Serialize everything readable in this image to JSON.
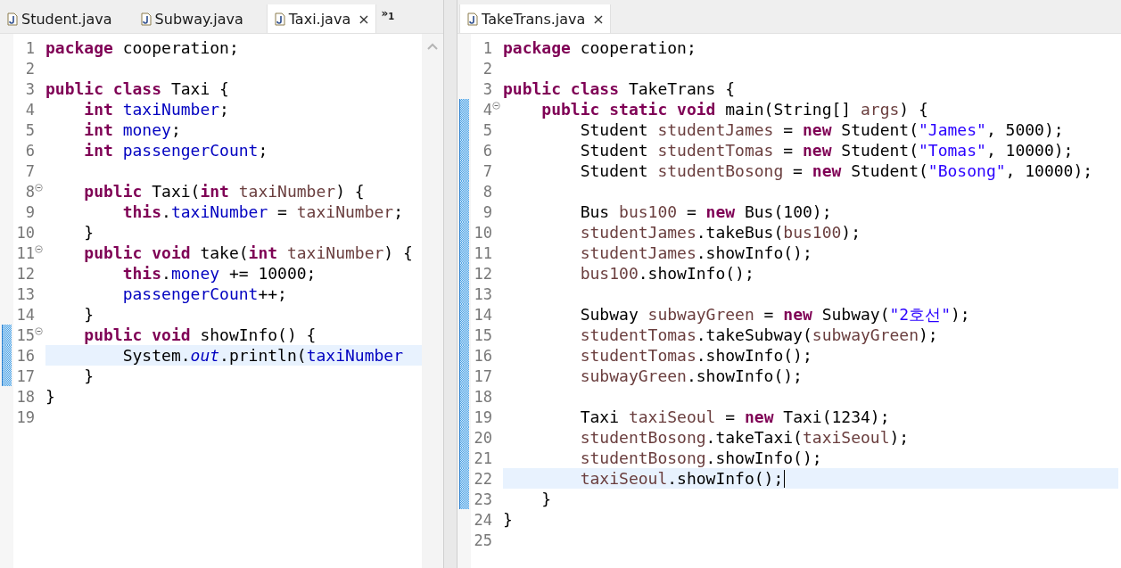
{
  "editors": [
    {
      "tabs": [
        {
          "label": "Student.java",
          "selected": false
        },
        {
          "label": "Subway.java",
          "selected": false
        },
        {
          "label": "Taxi.java",
          "selected": true,
          "close": "×"
        }
      ],
      "overflow": "»$_{1}$",
      "lines": [
        {
          "number": "1",
          "tokens": [
            {
              "kind": "kw",
              "text": "package"
            },
            {
              "kind": "plain",
              "text": " cooperation;"
            }
          ]
        },
        {
          "number": "2"
        },
        {
          "number": "3",
          "tokens": [
            {
              "kind": "kw",
              "text": "public class"
            },
            {
              "kind": "plain",
              "text": " Taxi {"
            }
          ]
        },
        {
          "number": "4",
          "tokens": [
            {
              "kind": "kw",
              "text": "    int"
            },
            {
              "kind": "field",
              "text": " taxiNumber"
            },
            {
              "kind": "plain",
              "text": ";"
            }
          ]
        },
        {
          "number": "5",
          "tokens": [
            {
              "kind": "kw",
              "text": "    int"
            },
            {
              "kind": "field",
              "text": " money"
            },
            {
              "kind": "plain",
              "text": ";"
            }
          ]
        },
        {
          "number": "6",
          "tokens": [
            {
              "kind": "kw",
              "text": "    int"
            },
            {
              "kind": "field",
              "text": " passengerCount"
            },
            {
              "kind": "plain",
              "text": ";"
            }
          ]
        },
        {
          "number": "7"
        },
        {
          "number": "8",
          "fold": true,
          "tokens": [
            {
              "kind": "kw",
              "text": "    public"
            },
            {
              "kind": "plain",
              "text": " Taxi("
            },
            {
              "kind": "kw",
              "text": "int"
            },
            {
              "kind": "var",
              "text": " taxiNumber"
            },
            {
              "kind": "plain",
              "text": ") {"
            }
          ]
        },
        {
          "number": "9",
          "tokens": [
            {
              "kind": "kw",
              "text": "        this"
            },
            {
              "kind": "plain",
              "text": "."
            },
            {
              "kind": "field",
              "text": "taxiNumber"
            },
            {
              "kind": "plain",
              "text": " = "
            },
            {
              "kind": "var",
              "text": "taxiNumber"
            },
            {
              "kind": "plain",
              "text": ";"
            }
          ]
        },
        {
          "number": "10",
          "tokens": [
            {
              "kind": "plain",
              "text": "    }"
            }
          ]
        },
        {
          "number": "11",
          "fold": true,
          "tokens": [
            {
              "kind": "kw",
              "text": "    public void"
            },
            {
              "kind": "plain",
              "text": " take("
            },
            {
              "kind": "kw",
              "text": "int"
            },
            {
              "kind": "var",
              "text": " taxiNumber"
            },
            {
              "kind": "plain",
              "text": ") {"
            }
          ]
        },
        {
          "number": "12",
          "tokens": [
            {
              "kind": "kw",
              "text": "        this"
            },
            {
              "kind": "plain",
              "text": "."
            },
            {
              "kind": "field",
              "text": "money"
            },
            {
              "kind": "plain",
              "text": " += 10000;"
            }
          ]
        },
        {
          "number": "13",
          "tokens": [
            {
              "kind": "field",
              "text": "        passengerCount"
            },
            {
              "kind": "plain",
              "text": "++;"
            }
          ]
        },
        {
          "number": "14",
          "tokens": [
            {
              "kind": "plain",
              "text": "    }"
            }
          ]
        },
        {
          "number": "15",
          "fold": true,
          "changed": true,
          "tokens": [
            {
              "kind": "kw",
              "text": "    public void"
            },
            {
              "kind": "plain",
              "text": " showInfo() {"
            }
          ]
        },
        {
          "number": "16",
          "changed": true,
          "current": true,
          "tokens": [
            {
              "kind": "plain",
              "text": "        System."
            },
            {
              "kind": "static",
              "text": "out"
            },
            {
              "kind": "plain",
              "text": ".println("
            },
            {
              "kind": "field",
              "text": "taxiNumber"
            }
          ]
        },
        {
          "number": "17",
          "changed": true,
          "tokens": [
            {
              "kind": "plain",
              "text": "    }"
            }
          ]
        },
        {
          "number": "18",
          "tokens": [
            {
              "kind": "plain",
              "text": "}"
            }
          ]
        },
        {
          "number": "19"
        }
      ]
    },
    {
      "tabs": [
        {
          "label": "TakeTrans.java",
          "selected": true,
          "close": "×"
        }
      ],
      "lines": [
        {
          "number": "1",
          "tokens": [
            {
              "kind": "kw",
              "text": "package"
            },
            {
              "kind": "plain",
              "text": " cooperation;"
            }
          ]
        },
        {
          "number": "2"
        },
        {
          "number": "3",
          "tokens": [
            {
              "kind": "kw",
              "text": "public class"
            },
            {
              "kind": "plain",
              "text": " TakeTrans {"
            }
          ]
        },
        {
          "number": "4",
          "fold": true,
          "changed": true,
          "tokens": [
            {
              "kind": "kw",
              "text": "    public static void"
            },
            {
              "kind": "plain",
              "text": " main(String[] "
            },
            {
              "kind": "var",
              "text": "args"
            },
            {
              "kind": "plain",
              "text": ") {"
            }
          ]
        },
        {
          "number": "5",
          "changed": true,
          "tokens": [
            {
              "kind": "plain",
              "text": "        Student "
            },
            {
              "kind": "var",
              "text": "studentJames"
            },
            {
              "kind": "plain",
              "text": " = "
            },
            {
              "kind": "kw",
              "text": "new"
            },
            {
              "kind": "plain",
              "text": " Student("
            },
            {
              "kind": "str",
              "text": "\"James\""
            },
            {
              "kind": "plain",
              "text": ", 5000);"
            }
          ]
        },
        {
          "number": "6",
          "changed": true,
          "tokens": [
            {
              "kind": "plain",
              "text": "        Student "
            },
            {
              "kind": "var",
              "text": "studentTomas"
            },
            {
              "kind": "plain",
              "text": " = "
            },
            {
              "kind": "kw",
              "text": "new"
            },
            {
              "kind": "plain",
              "text": " Student("
            },
            {
              "kind": "str",
              "text": "\"Tomas\""
            },
            {
              "kind": "plain",
              "text": ", 10000);"
            }
          ]
        },
        {
          "number": "7",
          "changed": true,
          "tokens": [
            {
              "kind": "plain",
              "text": "        Student "
            },
            {
              "kind": "var",
              "text": "studentBosong"
            },
            {
              "kind": "plain",
              "text": " = "
            },
            {
              "kind": "kw",
              "text": "new"
            },
            {
              "kind": "plain",
              "text": " Student("
            },
            {
              "kind": "str",
              "text": "\"Bosong\""
            },
            {
              "kind": "plain",
              "text": ", 10000);"
            }
          ]
        },
        {
          "number": "8",
          "changed": true
        },
        {
          "number": "9",
          "changed": true,
          "tokens": [
            {
              "kind": "plain",
              "text": "        Bus "
            },
            {
              "kind": "var",
              "text": "bus100"
            },
            {
              "kind": "plain",
              "text": " = "
            },
            {
              "kind": "kw",
              "text": "new"
            },
            {
              "kind": "plain",
              "text": " Bus(100);"
            }
          ]
        },
        {
          "number": "10",
          "changed": true,
          "tokens": [
            {
              "kind": "var",
              "text": "        studentJames"
            },
            {
              "kind": "plain",
              "text": ".takeBus("
            },
            {
              "kind": "var",
              "text": "bus100"
            },
            {
              "kind": "plain",
              "text": ");"
            }
          ]
        },
        {
          "number": "11",
          "changed": true,
          "tokens": [
            {
              "kind": "var",
              "text": "        studentJames"
            },
            {
              "kind": "plain",
              "text": ".showInfo();"
            }
          ]
        },
        {
          "number": "12",
          "changed": true,
          "tokens": [
            {
              "kind": "var",
              "text": "        bus100"
            },
            {
              "kind": "plain",
              "text": ".showInfo();"
            }
          ]
        },
        {
          "number": "13",
          "changed": true
        },
        {
          "number": "14",
          "changed": true,
          "tokens": [
            {
              "kind": "plain",
              "text": "        Subway "
            },
            {
              "kind": "var",
              "text": "subwayGreen"
            },
            {
              "kind": "plain",
              "text": " = "
            },
            {
              "kind": "kw",
              "text": "new"
            },
            {
              "kind": "plain",
              "text": " Subway("
            },
            {
              "kind": "str",
              "text": "\"2호선\""
            },
            {
              "kind": "plain",
              "text": ");"
            }
          ]
        },
        {
          "number": "15",
          "changed": true,
          "tokens": [
            {
              "kind": "var",
              "text": "        studentTomas"
            },
            {
              "kind": "plain",
              "text": ".takeSubway("
            },
            {
              "kind": "var",
              "text": "subwayGreen"
            },
            {
              "kind": "plain",
              "text": ");"
            }
          ]
        },
        {
          "number": "16",
          "changed": true,
          "tokens": [
            {
              "kind": "var",
              "text": "        studentTomas"
            },
            {
              "kind": "plain",
              "text": ".showInfo();"
            }
          ]
        },
        {
          "number": "17",
          "changed": true,
          "tokens": [
            {
              "kind": "var",
              "text": "        subwayGreen"
            },
            {
              "kind": "plain",
              "text": ".showInfo();"
            }
          ]
        },
        {
          "number": "18",
          "changed": true
        },
        {
          "number": "19",
          "changed": true,
          "tokens": [
            {
              "kind": "plain",
              "text": "        Taxi "
            },
            {
              "kind": "var",
              "text": "taxiSeoul"
            },
            {
              "kind": "plain",
              "text": " = "
            },
            {
              "kind": "kw",
              "text": "new"
            },
            {
              "kind": "plain",
              "text": " Taxi(1234);"
            }
          ]
        },
        {
          "number": "20",
          "changed": true,
          "tokens": [
            {
              "kind": "var",
              "text": "        studentBosong"
            },
            {
              "kind": "plain",
              "text": ".takeTaxi("
            },
            {
              "kind": "var",
              "text": "taxiSeoul"
            },
            {
              "kind": "plain",
              "text": ");"
            }
          ]
        },
        {
          "number": "21",
          "changed": true,
          "tokens": [
            {
              "kind": "var",
              "text": "        studentBosong"
            },
            {
              "kind": "plain",
              "text": ".showInfo();"
            }
          ]
        },
        {
          "number": "22",
          "changed": true,
          "current": true,
          "cursor": true,
          "tokens": [
            {
              "kind": "var",
              "text": "        taxiSeoul"
            },
            {
              "kind": "plain",
              "text": ".showInfo();"
            }
          ]
        },
        {
          "number": "23",
          "changed": true,
          "tokens": [
            {
              "kind": "plain",
              "text": "    }"
            }
          ]
        },
        {
          "number": "24",
          "tokens": [
            {
              "kind": "plain",
              "text": "}"
            }
          ]
        },
        {
          "number": "25"
        }
      ]
    }
  ]
}
